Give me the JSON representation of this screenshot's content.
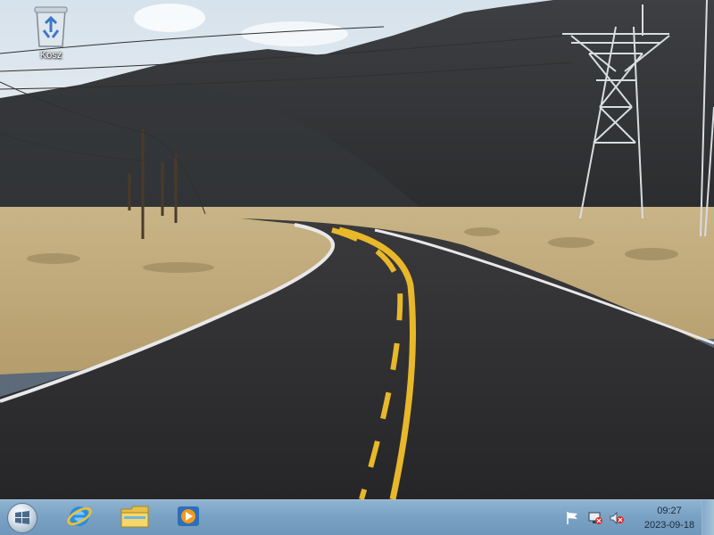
{
  "desktop": {
    "icons": [
      {
        "label": "Kosz",
        "icon": "recycle-bin-icon"
      }
    ]
  },
  "taskbar": {
    "start_icon": "windows-start-icon",
    "pinned": [
      {
        "name": "Internet Explorer",
        "icon": "internet-explorer-icon"
      },
      {
        "name": "File Explorer",
        "icon": "file-explorer-icon"
      },
      {
        "name": "Windows Media Player",
        "icon": "media-player-icon"
      }
    ],
    "tray": {
      "icons": [
        "action-center-flag-icon",
        "network-icon",
        "volume-muted-icon"
      ],
      "time": "09:27",
      "date": "2023-09-18"
    }
  },
  "colors": {
    "taskbar": "#7aa2c4",
    "road": "#2e2e30",
    "center_line": "#e8b82a",
    "sky": "#dfe7ee"
  }
}
